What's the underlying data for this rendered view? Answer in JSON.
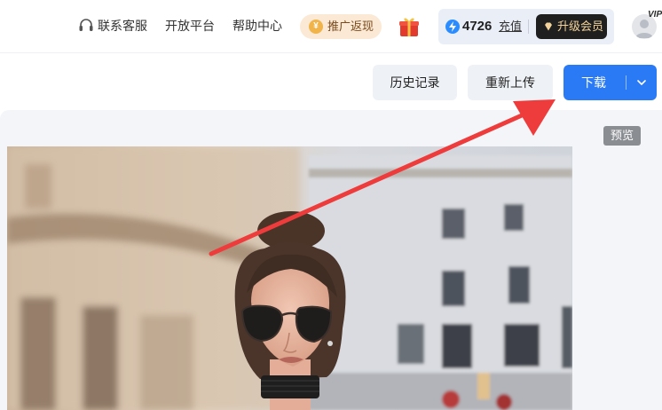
{
  "header": {
    "nav": [
      "联系客服",
      "开放平台",
      "帮助中心"
    ],
    "promo_label": "推广返现",
    "credits": "4726",
    "recharge_label": "充值",
    "upgrade_label": "升级会员",
    "vip_badge": "VIP"
  },
  "toolbar": {
    "history_label": "历史记录",
    "reupload_label": "重新上传",
    "download_label": "下载"
  },
  "preview": {
    "tag_label": "预览"
  },
  "colors": {
    "primary": "#2a7af6",
    "annotation_arrow": "#ee3b3b",
    "promo_bg": "#fbe9d5",
    "upgrade_bg": "#1f1f1f"
  },
  "icons": [
    "headset-icon",
    "coin-icon",
    "gift-icon",
    "bolt-icon",
    "diamond-icon",
    "avatar-icon",
    "chevron-down-icon",
    "arrow-annotation"
  ]
}
